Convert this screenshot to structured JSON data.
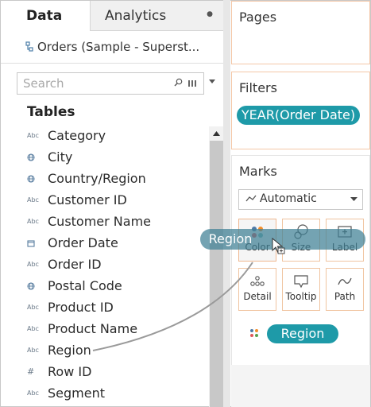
{
  "tabs": {
    "data": "Data",
    "analytics": "Analytics"
  },
  "datasource": {
    "name": "Orders (Sample - Superst..."
  },
  "search": {
    "placeholder": "Search"
  },
  "tables_heading": "Tables",
  "fields": [
    {
      "type": "Abc",
      "name": "Category"
    },
    {
      "type": "geo",
      "name": "City"
    },
    {
      "type": "geo",
      "name": "Country/Region"
    },
    {
      "type": "Abc",
      "name": "Customer ID"
    },
    {
      "type": "Abc",
      "name": "Customer Name"
    },
    {
      "type": "date",
      "name": "Order Date"
    },
    {
      "type": "Abc",
      "name": "Order ID"
    },
    {
      "type": "geo",
      "name": "Postal Code"
    },
    {
      "type": "Abc",
      "name": "Product ID"
    },
    {
      "type": "Abc",
      "name": "Product Name"
    },
    {
      "type": "Abc",
      "name": "Region"
    },
    {
      "type": "#",
      "name": "Row ID"
    },
    {
      "type": "Abc",
      "name": "Segment"
    }
  ],
  "pages": {
    "title": "Pages"
  },
  "filters": {
    "title": "Filters",
    "pill": "YEAR(Order Date)"
  },
  "marks": {
    "title": "Marks",
    "mark_type": "Automatic",
    "buttons": [
      "Color",
      "Size",
      "Label",
      "Detail",
      "Tooltip",
      "Path"
    ],
    "pill": "Region"
  },
  "drag": {
    "label": "Region"
  },
  "colors": {
    "accent": "#1e9aa8",
    "drag": "#3e7f94",
    "card_border": "#f4c8a8"
  }
}
